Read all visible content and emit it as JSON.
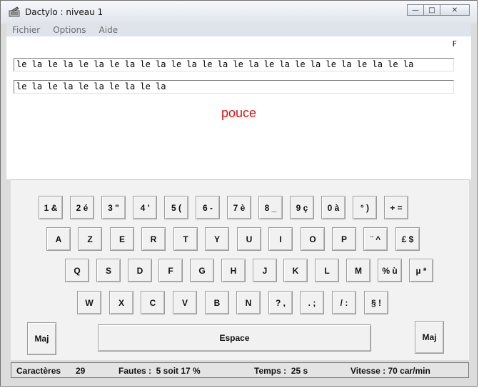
{
  "window": {
    "title": "Dactylo : niveau 1",
    "controls": {
      "minimize": "—",
      "maximize": "□",
      "close": "✕"
    }
  },
  "menubar": {
    "items": [
      "Fichier",
      "Options",
      "Aide"
    ]
  },
  "main": {
    "indicator": "F",
    "model_text": "le la le la le la le la le la le la le la le la le la le la le la le la le la",
    "typed_text": "le la le la le la le la le la",
    "finger_hint": "pouce"
  },
  "keyboard": {
    "row1": [
      "1 &",
      "2 é",
      "3 \"",
      "4 '",
      "5 (",
      "6 -",
      "7 è",
      "8 _",
      "9 ç",
      "0 à",
      "° )",
      "+ ="
    ],
    "row2": [
      "A",
      "Z",
      "E",
      "R",
      "T",
      "Y",
      "U",
      "I",
      "O",
      "P",
      "¨ ^",
      "£ $"
    ],
    "row3": [
      "Q",
      "S",
      "D",
      "F",
      "G",
      "H",
      "J",
      "K",
      "L",
      "M",
      "% ù",
      "µ *"
    ],
    "row4": [
      "W",
      "X",
      "C",
      "V",
      "B",
      "N",
      "? ,",
      ". ;",
      "/ :",
      "§ !"
    ],
    "left_shift": "Maj",
    "space": "Espace",
    "right_shift": "Maj"
  },
  "status": {
    "chars_label": "Caractères",
    "chars_value": "29",
    "errors": "Fautes :  5 soit 17 %",
    "time": "Temps :  25 s",
    "speed": "Vitesse : 70 car/min"
  }
}
